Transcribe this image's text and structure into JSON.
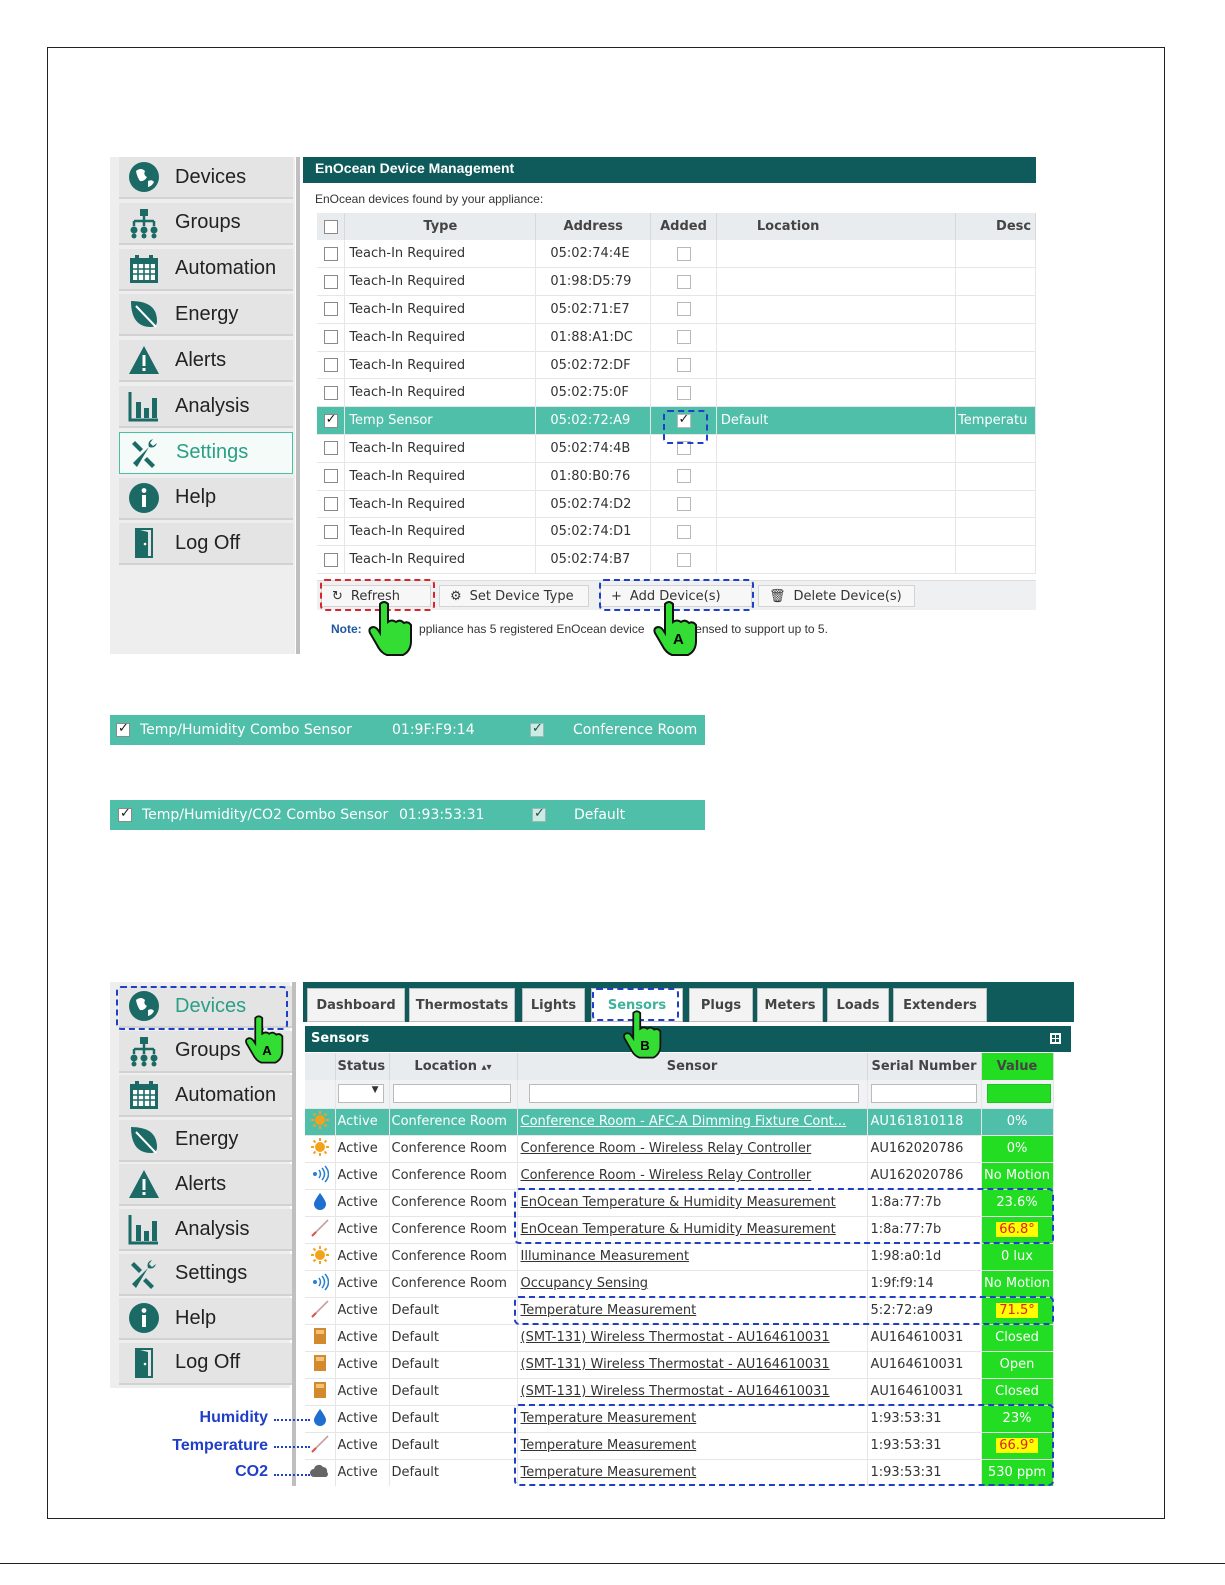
{
  "nav": {
    "items": [
      {
        "label": "Devices",
        "icon": "globe-icon"
      },
      {
        "label": "Groups",
        "icon": "network-icon"
      },
      {
        "label": "Automation",
        "icon": "calendar-icon"
      },
      {
        "label": "Energy",
        "icon": "leaf-icon"
      },
      {
        "label": "Alerts",
        "icon": "warning-icon"
      },
      {
        "label": "Analysis",
        "icon": "bar-chart-icon"
      },
      {
        "label": "Settings",
        "icon": "tools-icon"
      },
      {
        "label": "Help",
        "icon": "info-icon"
      },
      {
        "label": "Log Off",
        "icon": "door-icon"
      }
    ]
  },
  "enocean": {
    "title": "EnOcean Device Management",
    "subtitle": "EnOcean devices found by your appliance:",
    "columns": [
      "Type",
      "Address",
      "Added",
      "Location",
      "Desc"
    ],
    "rows": [
      {
        "checked": false,
        "type": "Teach-In Required",
        "address": "05:02:74:4E",
        "added": false,
        "location": "",
        "desc": ""
      },
      {
        "checked": false,
        "type": "Teach-In Required",
        "address": "01:98:D5:79",
        "added": false,
        "location": "",
        "desc": ""
      },
      {
        "checked": false,
        "type": "Teach-In Required",
        "address": "05:02:71:E7",
        "added": false,
        "location": "",
        "desc": ""
      },
      {
        "checked": false,
        "type": "Teach-In Required",
        "address": "01:88:A1:DC",
        "added": false,
        "location": "",
        "desc": ""
      },
      {
        "checked": false,
        "type": "Teach-In Required",
        "address": "05:02:72:DF",
        "added": false,
        "location": "",
        "desc": ""
      },
      {
        "checked": false,
        "type": "Teach-In Required",
        "address": "05:02:75:0F",
        "added": false,
        "location": "",
        "desc": ""
      },
      {
        "checked": true,
        "type": "Temp Sensor",
        "address": "05:02:72:A9",
        "added": true,
        "location": "Default",
        "desc": "Temperatu",
        "selected": true
      },
      {
        "checked": false,
        "type": "Teach-In Required",
        "address": "05:02:74:4B",
        "added": false,
        "location": "",
        "desc": ""
      },
      {
        "checked": false,
        "type": "Teach-In Required",
        "address": "01:80:B0:76",
        "added": false,
        "location": "",
        "desc": ""
      },
      {
        "checked": false,
        "type": "Teach-In Required",
        "address": "05:02:74:D2",
        "added": false,
        "location": "",
        "desc": ""
      },
      {
        "checked": false,
        "type": "Teach-In Required",
        "address": "05:02:74:D1",
        "added": false,
        "location": "",
        "desc": ""
      },
      {
        "checked": false,
        "type": "Teach-In Required",
        "address": "05:02:74:B7",
        "added": false,
        "location": "",
        "desc": ""
      }
    ],
    "toolbar": {
      "refresh": "Refresh",
      "set_type": "Set Device Type",
      "add": "Add Device(s)",
      "delete": "Delete Device(s)"
    },
    "note_label": "Note:",
    "note_text": "ppliance has 5 registered EnOcean device",
    "note_text2": "s licensed to support up to 5.",
    "callout_a": "A"
  },
  "strips": [
    {
      "type": "Temp/Humidity Combo Sensor",
      "address": "01:9F:F9:14",
      "location": "Conference Room"
    },
    {
      "type": "Temp/Humidity/CO2 Combo Sensor",
      "address": "01:93:53:31",
      "location": "Default"
    }
  ],
  "sensors_page": {
    "tabs": [
      "Dashboard",
      "Thermostats",
      "Lights",
      "Sensors",
      "Plugs",
      "Meters",
      "Loads",
      "Extenders"
    ],
    "active_tab": "Sensors",
    "title": "Sensors",
    "columns": [
      "Status",
      "Location",
      "Sensor",
      "Serial Number",
      "Value"
    ],
    "rows": [
      {
        "icon": "sun-icon",
        "status": "Active",
        "location": "Conference Room",
        "sensor": "Conference Room - AFC-A Dimming Fixture Cont...",
        "serial": "AU161810118",
        "value": "0%",
        "highlight": true
      },
      {
        "icon": "sun-icon",
        "status": "Active",
        "location": "Conference Room",
        "sensor": "Conference Room - Wireless Relay Controller",
        "serial": "AU162020786",
        "value": "0%"
      },
      {
        "icon": "motion-icon",
        "status": "Active",
        "location": "Conference Room",
        "sensor": "Conference Room - Wireless Relay Controller",
        "serial": "AU162020786",
        "value": "No Motion"
      },
      {
        "icon": "droplet-icon",
        "status": "Active",
        "location": "Conference Room",
        "sensor": "EnOcean Temperature & Humidity Measurement",
        "serial": "1:8a:77:7b",
        "value": "23.6%"
      },
      {
        "icon": "thermometer-icon",
        "status": "Active",
        "location": "Conference Room",
        "sensor": "EnOcean Temperature & Humidity Measurement",
        "serial": "1:8a:77:7b",
        "value": "66.8°",
        "warn": true
      },
      {
        "icon": "sun-icon",
        "status": "Active",
        "location": "Conference Room",
        "sensor": "Illuminance Measurement",
        "serial": "1:98:a0:1d",
        "value": "0 lux"
      },
      {
        "icon": "motion-icon",
        "status": "Active",
        "location": "Conference Room",
        "sensor": "Occupancy Sensing",
        "serial": "1:9f:f9:14",
        "value": "No Motion"
      },
      {
        "icon": "thermometer-icon",
        "status": "Active",
        "location": "Default",
        "sensor": "Temperature Measurement",
        "serial": "5:2:72:a9",
        "value": "71.5°",
        "warn": true
      },
      {
        "icon": "thermostat-icon",
        "status": "Active",
        "location": "Default",
        "sensor": "(SMT-131) Wireless Thermostat - AU164610031",
        "serial": "AU164610031",
        "value": "Closed"
      },
      {
        "icon": "thermostat-icon",
        "status": "Active",
        "location": "Default",
        "sensor": "(SMT-131) Wireless Thermostat - AU164610031",
        "serial": "AU164610031",
        "value": "Open"
      },
      {
        "icon": "thermostat-icon",
        "status": "Active",
        "location": "Default",
        "sensor": "(SMT-131) Wireless Thermostat - AU164610031",
        "serial": "AU164610031",
        "value": "Closed"
      },
      {
        "icon": "droplet-icon",
        "status": "Active",
        "location": "Default",
        "sensor": "Temperature Measurement",
        "serial": "1:93:53:31",
        "value": "23%"
      },
      {
        "icon": "thermometer-icon",
        "status": "Active",
        "location": "Default",
        "sensor": "Temperature Measurement",
        "serial": "1:93:53:31",
        "value": "66.9°",
        "warn": true
      },
      {
        "icon": "cloud-icon",
        "status": "Active",
        "location": "Default",
        "sensor": "Temperature Measurement",
        "serial": "1:93:53:31",
        "value": "530 ppm"
      }
    ],
    "callout_a": "A",
    "callout_b": "B"
  },
  "legend": {
    "humidity": "Humidity",
    "temperature": "Temperature",
    "co2": "CO2"
  },
  "colors": {
    "teal_header": "#0f5a5a",
    "selected_row": "#4fbfa9",
    "value_green": "#22dd22",
    "callout_blue": "#1f3fc7",
    "callout_red": "#d9262c"
  }
}
